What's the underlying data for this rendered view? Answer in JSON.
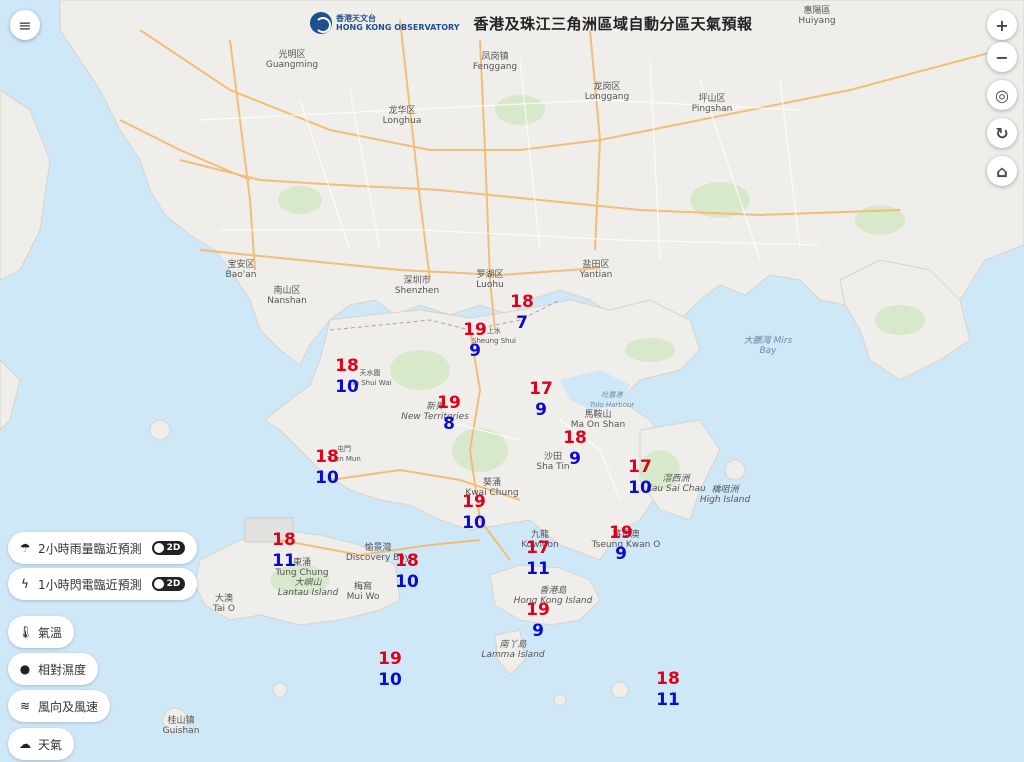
{
  "header": {
    "logo_zh": "香港天文台",
    "logo_en": "HONG KONG OBSERVATORY",
    "title": "香港及珠江三角洲區域自動分區天氣預報"
  },
  "controls": {
    "menu_icon": "menu-icon",
    "zoom_in": "+",
    "zoom_out": "−",
    "locate_icon": "locate-icon",
    "refresh_icon": "refresh-icon",
    "home_icon": "home-icon"
  },
  "layers": [
    {
      "label": "2小時雨量臨近預測",
      "icon": "rain-cloud-icon",
      "toggle": "2D"
    },
    {
      "label": "1小時閃電臨近預測",
      "icon": "lightning-icon",
      "toggle": "2D"
    },
    {
      "label": "氣溫",
      "icon": "thermometer-icon"
    },
    {
      "label": "相對濕度",
      "icon": "droplet-icon"
    },
    {
      "label": "風向及風速",
      "icon": "wind-icon"
    },
    {
      "label": "天氣",
      "icon": "weather-icon"
    }
  ],
  "places": [
    {
      "zh": "惠陽區",
      "en": "Huiyang"
    },
    {
      "zh": "光明区",
      "en": "Guangming"
    },
    {
      "zh": "凤岗镇",
      "en": "Fenggang"
    },
    {
      "zh": "龙华区",
      "en": "Longhua"
    },
    {
      "zh": "龙岗区",
      "en": "Longgang"
    },
    {
      "zh": "坪山区",
      "en": "Pingshan"
    },
    {
      "zh": "宝安区",
      "en": "Bao'an"
    },
    {
      "zh": "南山区",
      "en": "Nanshan"
    },
    {
      "zh": "深圳市",
      "en": "Shenzhen"
    },
    {
      "zh": "罗湖区",
      "en": "Luohu"
    },
    {
      "zh": "盐田区",
      "en": "Yantian"
    },
    {
      "zh": "大鵬灣 Mirs",
      "en": "Bay"
    },
    {
      "zh": "吐露港",
      "en": "Tolo Harbour"
    },
    {
      "zh": "新界",
      "en": "New Territories"
    },
    {
      "zh": "馬鞍山",
      "en": "Ma On Shan"
    },
    {
      "zh": "沙田",
      "en": "Sha Tin"
    },
    {
      "zh": "葵涌",
      "en": "Kwai Chung"
    },
    {
      "zh": "九龍",
      "en": "Kowloon"
    },
    {
      "zh": "將軍澳",
      "en": "Tseung Kwan O"
    },
    {
      "zh": "滘西洲",
      "en": "Kau Sai Chau"
    },
    {
      "zh": "橋咀洲",
      "en": "High Island"
    },
    {
      "zh": "香港島",
      "en": "Hong Kong Island"
    },
    {
      "zh": "南丫島",
      "en": "Lamma Island"
    },
    {
      "zh": "大嶼山",
      "en": "Lantau Island"
    },
    {
      "zh": "東涌",
      "en": "Tung Chung"
    },
    {
      "zh": "愉景灣",
      "en": "Discovery Bay"
    },
    {
      "zh": "梅窩",
      "en": "Mui Wo"
    },
    {
      "zh": "大澳",
      "en": "Tai O"
    },
    {
      "zh": "桂山镇",
      "en": "Guishan"
    },
    {
      "zh": "屯門",
      "en": "Tuen Mun"
    },
    {
      "zh": "天水圍",
      "en": "Tin Shui Wai"
    },
    {
      "zh": "上水",
      "en": "Sheung Shui"
    }
  ],
  "temps": [
    {
      "hi": "18",
      "lo": "7"
    },
    {
      "hi": "19",
      "lo": "9"
    },
    {
      "hi": "18",
      "lo": "10"
    },
    {
      "hi": "19",
      "lo": "8"
    },
    {
      "hi": "17",
      "lo": "9"
    },
    {
      "hi": "18",
      "lo": "9"
    },
    {
      "hi": "18",
      "lo": "10"
    },
    {
      "hi": "17",
      "lo": "10"
    },
    {
      "hi": "19",
      "lo": "10"
    },
    {
      "hi": "19",
      "lo": "9"
    },
    {
      "hi": "17",
      "lo": "11"
    },
    {
      "hi": "18",
      "lo": "11"
    },
    {
      "hi": "18",
      "lo": "10"
    },
    {
      "hi": "19",
      "lo": "9"
    },
    {
      "hi": "19",
      "lo": "10"
    },
    {
      "hi": "18",
      "lo": "11"
    }
  ]
}
